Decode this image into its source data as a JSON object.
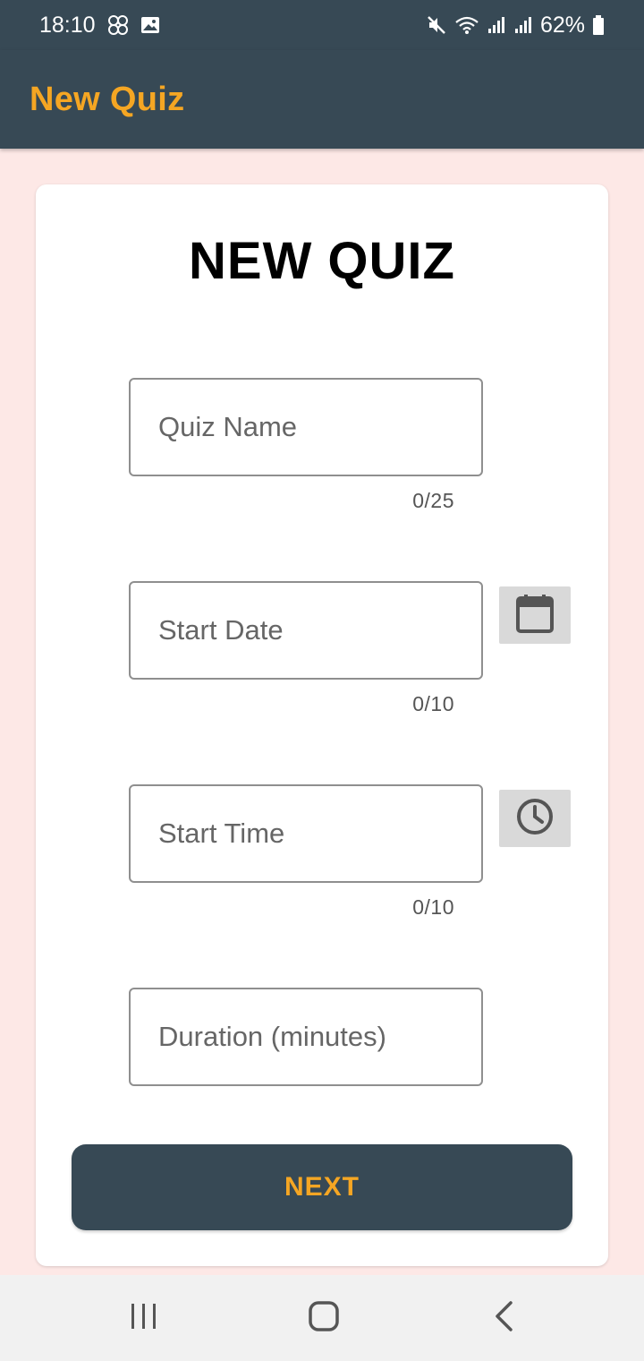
{
  "status_bar": {
    "time": "18:10",
    "battery": "62%"
  },
  "app_bar": {
    "title": "New Quiz"
  },
  "form": {
    "heading": "NEW QUIZ",
    "quiz_name": {
      "placeholder": "Quiz Name",
      "counter": "0/25"
    },
    "start_date": {
      "placeholder": "Start Date",
      "counter": "0/10"
    },
    "start_time": {
      "placeholder": "Start Time",
      "counter": "0/10"
    },
    "duration": {
      "placeholder": "Duration (minutes)"
    },
    "next_label": "NEXT"
  },
  "icons": {
    "date_picker": "calendar-icon",
    "time_picker": "clock-icon",
    "nav": [
      "recents-icon",
      "home-icon",
      "back-icon"
    ]
  },
  "colors": {
    "primary": "#374955",
    "accent": "#f5a623",
    "background": "#fde8e6"
  }
}
